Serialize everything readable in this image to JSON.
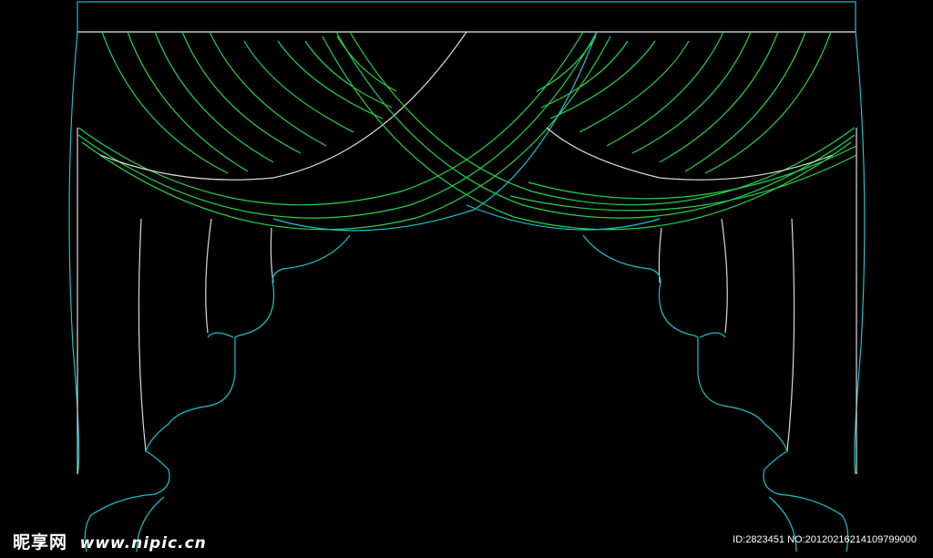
{
  "colors": {
    "background": "#000000",
    "frame": "#19c2cc",
    "valance_folds": "#22d34a",
    "highlight": "#d9d9d9",
    "watermark": "#ffffff"
  },
  "watermark": {
    "logo": "昵享网",
    "site": "www.nipic.cn",
    "id": "ID:2823451 NO:20120216214109799000"
  }
}
